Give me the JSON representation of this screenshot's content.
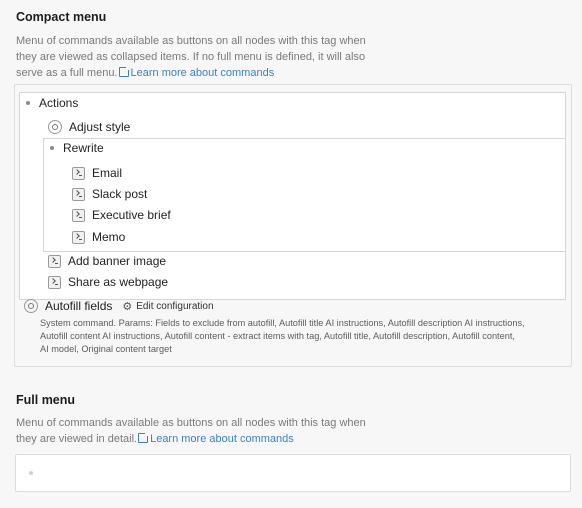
{
  "compact": {
    "title": "Compact menu",
    "desc_line1": "Menu of commands available as buttons on all nodes with this tag when",
    "desc_line2": "they are viewed as collapsed items. If no full menu is defined, it will also",
    "desc_line3_prefix": "serve as a full menu.",
    "link_label": "Learn more about commands"
  },
  "tree": {
    "actions": "Actions",
    "adjust_style": "Adjust style",
    "rewrite": "Rewrite",
    "email": "Email",
    "slack_post": "Slack post",
    "executive_brief": "Executive brief",
    "memo": "Memo",
    "add_banner": "Add banner image",
    "share_webpage": "Share as webpage",
    "autofill": "Autofill fields",
    "edit_config": "Edit configuration",
    "sys_line1": "System command. Params: Fields to exclude from autofill, Autofill title AI instructions, Autofill description AI instructions,",
    "sys_line2": "Autofill content AI instructions, Autofill content - extract items with tag, Autofill title, Autofill description, Autofill content,",
    "sys_line3": "AI model, Original content target"
  },
  "full": {
    "title": "Full menu",
    "desc_line1": "Menu of commands available as buttons on all nodes with this tag when",
    "desc_line2_prefix": "they are viewed in detail.",
    "link_label": "Learn more about commands"
  }
}
